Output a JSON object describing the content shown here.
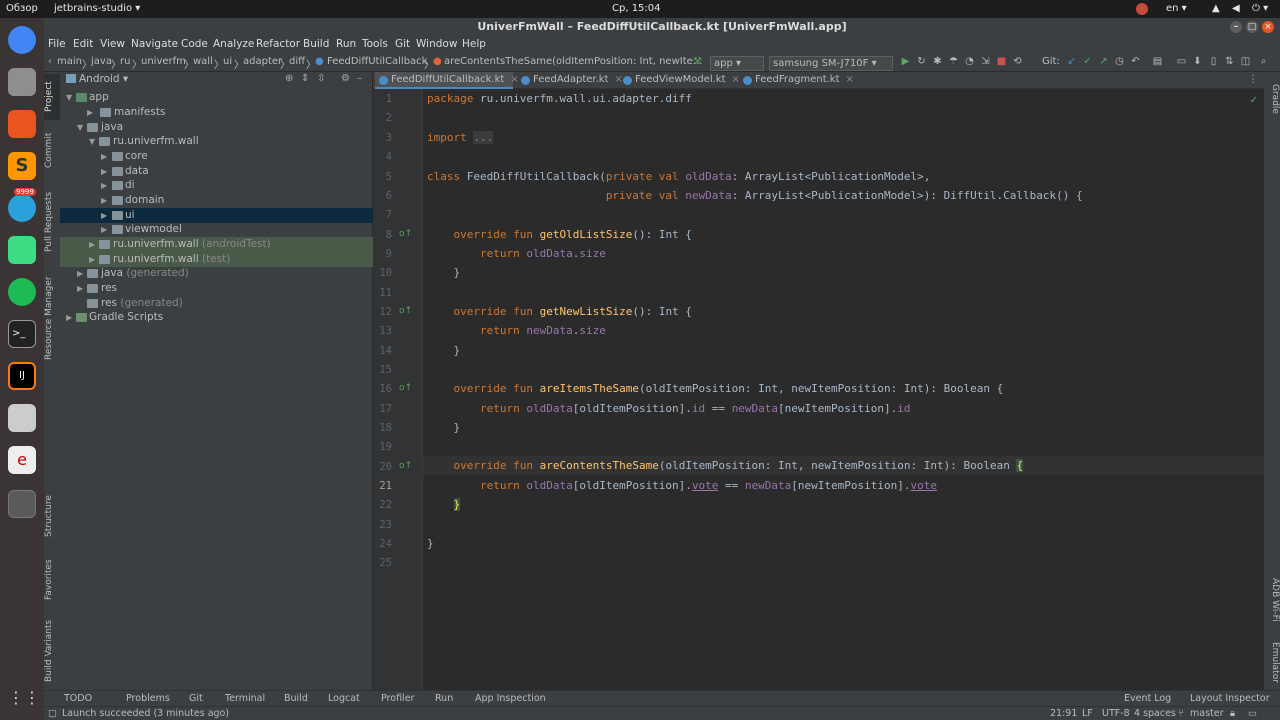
{
  "topbar": {
    "overview": "Обзор",
    "app_menu": "jetbrains-studio ▾",
    "clock": "Ср, 15:04",
    "lang": "en ▾"
  },
  "window": {
    "title": "UniverFmWall – FeedDiffUtilCallback.kt [UniverFmWall.app]"
  },
  "dock": {
    "telegram_badge": "9999"
  },
  "menu": [
    "File",
    "Edit",
    "View",
    "Navigate",
    "Code",
    "Analyze",
    "Refactor",
    "Build",
    "Run",
    "Tools",
    "Git",
    "Window",
    "Help"
  ],
  "navbar": {
    "crumbs": [
      "main",
      "java",
      "ru",
      "univerfm",
      "wall",
      "ui",
      "adapter",
      "diff",
      "FeedDiffUtilCallback",
      "areContentsTheSame(oldItemPosition: Int, newIte..."
    ],
    "run_config": "app ▾",
    "device": "samsung SM-J710F ▾",
    "git_label": "Git:"
  },
  "left_strip": [
    "Project",
    "Commit",
    "Pull Requests",
    "Resource Manager",
    "Structure",
    "Favorites",
    "Build Variants"
  ],
  "right_strip": [
    "Gradle",
    "ADB Wi-Fi",
    "Emulator"
  ],
  "project": {
    "view": "Android ▾",
    "tree": [
      {
        "label": "app",
        "sub": ""
      },
      {
        "label": "manifests",
        "sub": ""
      },
      {
        "label": "java",
        "sub": ""
      },
      {
        "label": "ru.univerfm.wall",
        "sub": ""
      },
      {
        "label": "core",
        "sub": ""
      },
      {
        "label": "data",
        "sub": ""
      },
      {
        "label": "di",
        "sub": ""
      },
      {
        "label": "domain",
        "sub": ""
      },
      {
        "label": "ui",
        "sub": ""
      },
      {
        "label": "viewmodel",
        "sub": ""
      },
      {
        "label": "ru.univerfm.wall",
        "sub": "(androidTest)"
      },
      {
        "label": "ru.univerfm.wall",
        "sub": "(test)"
      },
      {
        "label": "java",
        "sub": "(generated)"
      },
      {
        "label": "res",
        "sub": ""
      },
      {
        "label": "res",
        "sub": "(generated)"
      },
      {
        "label": "Gradle Scripts",
        "sub": ""
      }
    ]
  },
  "tabs": [
    "FeedDiffUtilCallback.kt",
    "FeedAdapter.kt",
    "FeedViewModel.kt",
    "FeedFragment.kt"
  ],
  "editor": {
    "line_numbers": [
      "1",
      "2",
      "3",
      "4",
      "5",
      "6",
      "7",
      "8",
      "9",
      "10",
      "11",
      "12",
      "13",
      "14",
      "15",
      "16",
      "17",
      "18",
      "19",
      "20",
      "21",
      "22",
      "23",
      "24",
      "25"
    ],
    "current_line": 21
  },
  "bottom_tabs": [
    "TODO",
    "Problems",
    "Git",
    "Terminal",
    "Build",
    "Logcat",
    "Profiler",
    "Run",
    "App Inspection",
    "Event Log",
    "Layout Inspector"
  ],
  "status": {
    "message": "Launch succeeded (3 minutes ago)",
    "position": "21:91",
    "line_sep": "LF",
    "encoding": "UTF-8",
    "indent": "4 spaces",
    "branch": "master"
  },
  "colors": {
    "keyword": "#cc7832",
    "function": "#ffc66d",
    "property": "#9876aa",
    "text": "#a9b7c6",
    "selection": "#0d293e"
  }
}
